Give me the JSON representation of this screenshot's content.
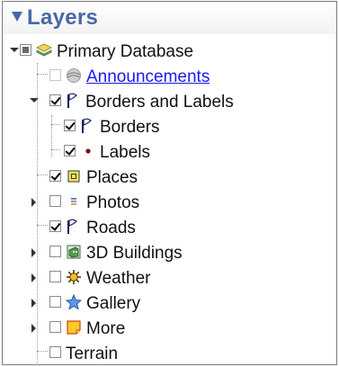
{
  "panel": {
    "title": "Layers",
    "collapse_icon": "triangle-down-icon",
    "accent_color": "#4a67a8"
  },
  "tree": {
    "root": {
      "label": "Primary Database",
      "state": "partial",
      "expanded": true,
      "icon": "database-layers-icon"
    },
    "items": [
      {
        "label": "Announcements",
        "state": "disabled",
        "icon": "globe-icon",
        "link": true,
        "link_color": "#1a1aee"
      },
      {
        "label": "Borders and Labels",
        "state": "checked",
        "icon": "flag-icon",
        "expanded": true,
        "children": [
          {
            "label": "Borders",
            "state": "checked",
            "icon": "flag-icon"
          },
          {
            "label": "Labels",
            "state": "checked",
            "icon": "dot-icon"
          }
        ]
      },
      {
        "label": "Places",
        "state": "checked",
        "icon": "places-box-icon"
      },
      {
        "label": "Photos",
        "state": "unchecked",
        "icon": "photo-icon",
        "expandable": true
      },
      {
        "label": "Roads",
        "state": "checked",
        "icon": "flag-icon"
      },
      {
        "label": "3D Buildings",
        "state": "unchecked",
        "icon": "building-icon",
        "expandable": true
      },
      {
        "label": "Weather",
        "state": "unchecked",
        "icon": "sun-icon",
        "expandable": true
      },
      {
        "label": "Gallery",
        "state": "unchecked",
        "icon": "star-icon",
        "expandable": true
      },
      {
        "label": "More",
        "state": "unchecked",
        "icon": "sticky-note-icon",
        "expandable": true
      },
      {
        "label": "Terrain",
        "state": "unchecked",
        "icon": ""
      }
    ]
  }
}
